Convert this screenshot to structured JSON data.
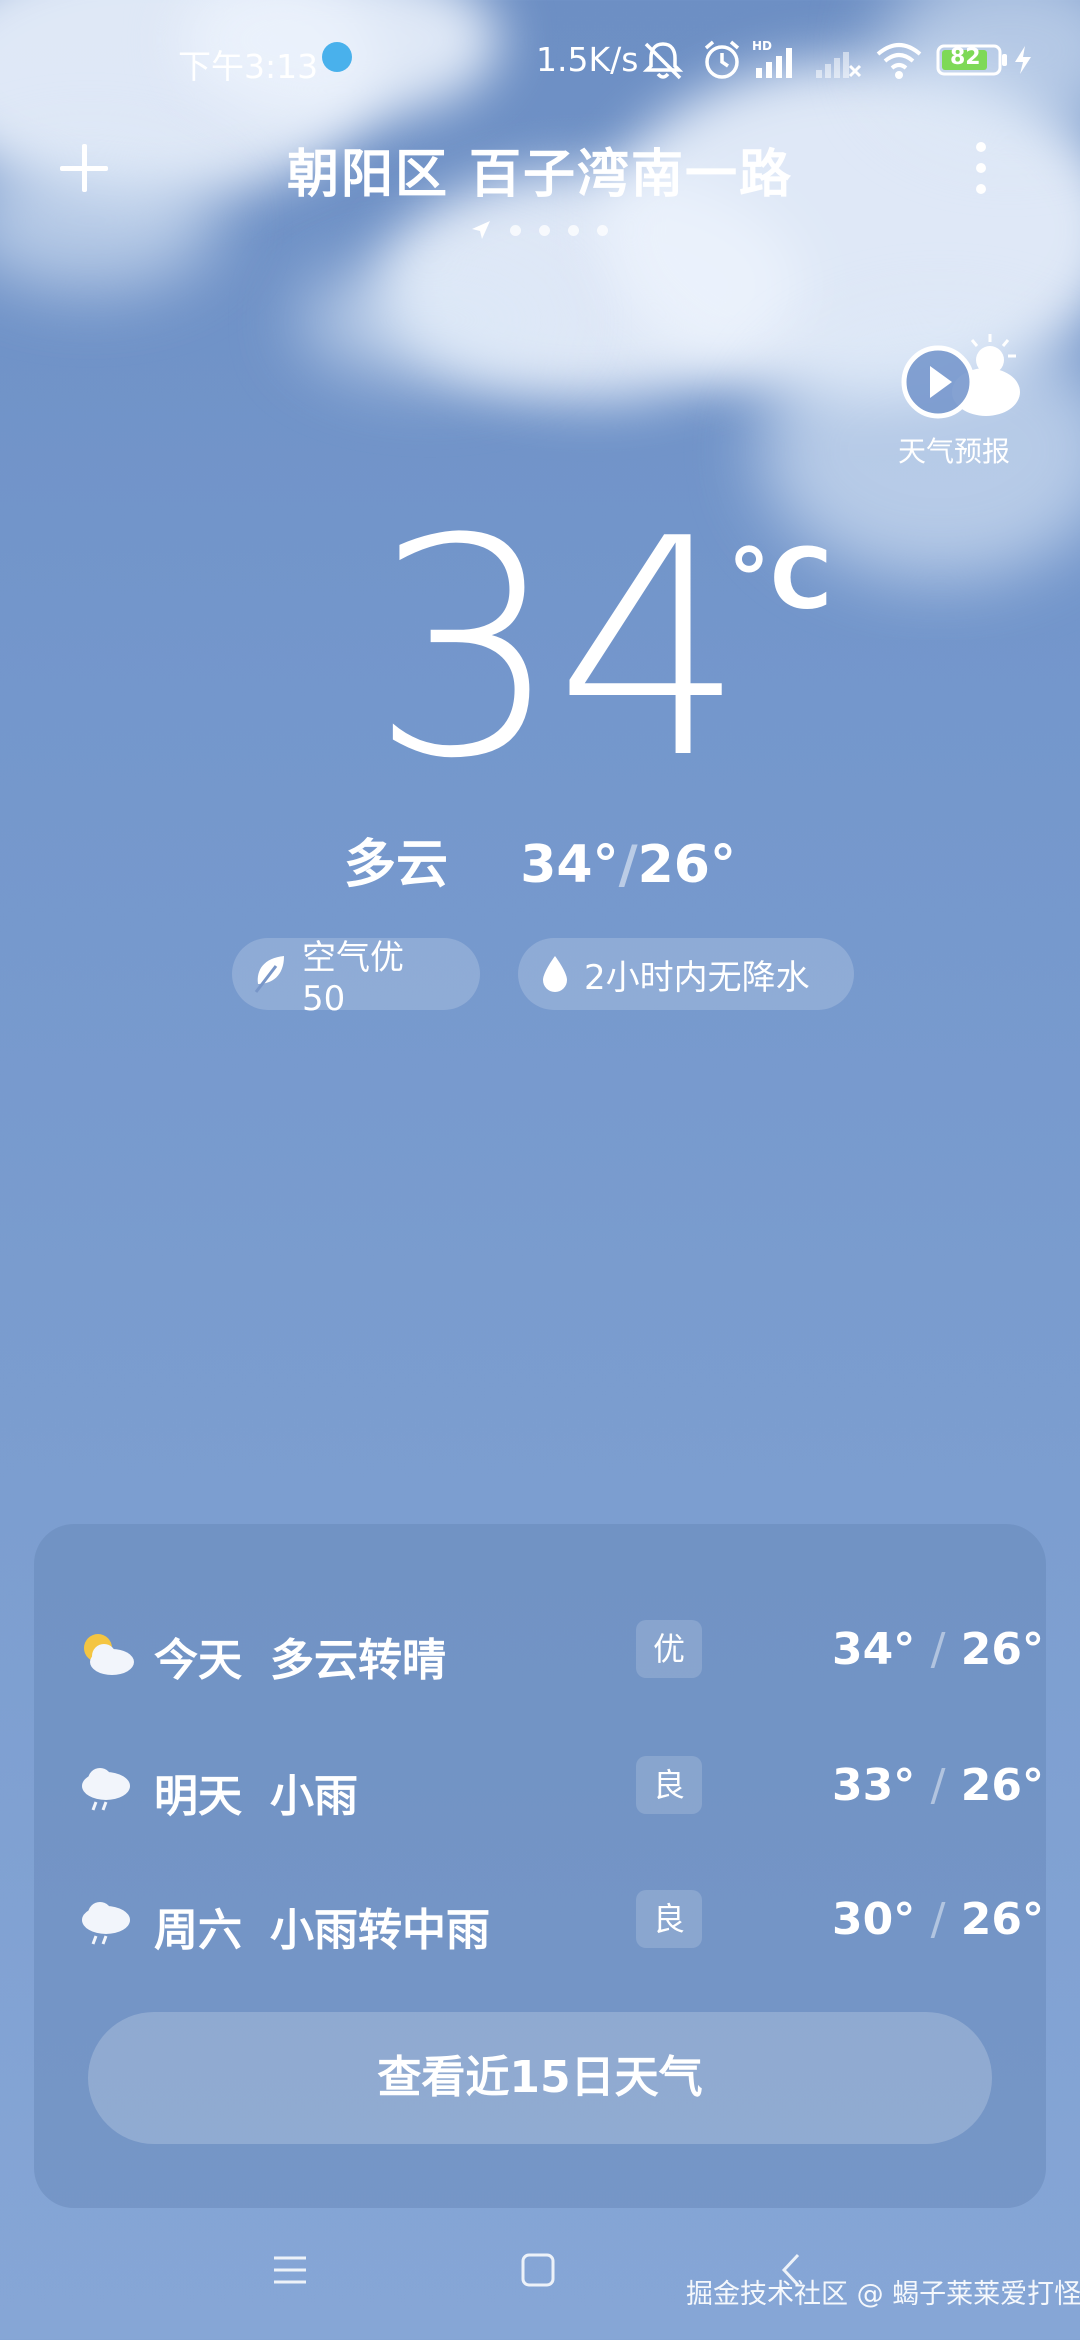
{
  "status_bar": {
    "time": "下午3:13",
    "net_speed": "1.5K/s",
    "battery": "82",
    "icons": [
      "mute-bell-icon",
      "alarm-icon",
      "hd-signal-icon",
      "signal-no-sim-icon",
      "wifi-icon",
      "battery-icon",
      "charging-icon"
    ]
  },
  "header": {
    "location": "朝阳区 百子湾南一路",
    "add_icon": "plus-icon",
    "more_icon": "vertical-dots-icon",
    "pages": [
      "location-arrow-icon",
      "dot",
      "dot",
      "dot",
      "dot"
    ]
  },
  "forecast_video": {
    "label": "天气预报",
    "icon": "play-sun-cloud-icon"
  },
  "current": {
    "temp": "34",
    "unit": "°C",
    "condition": "多云",
    "high": "34°",
    "low": "26°",
    "separator": "/"
  },
  "badges": [
    {
      "icon": "leaf-icon",
      "text": "空气优 50"
    },
    {
      "icon": "water-drop-icon",
      "text": "2小时内无降水"
    }
  ],
  "forecast": [
    {
      "icon": "partly-sunny-icon",
      "day": "今天",
      "condition": "多云转晴",
      "aqi": "优",
      "high": "34°",
      "low": "26°"
    },
    {
      "icon": "rain-cloud-icon",
      "day": "明天",
      "condition": "小雨",
      "aqi": "良",
      "high": "33°",
      "low": "26°"
    },
    {
      "icon": "rain-cloud-icon",
      "day": "周六",
      "condition": "小雨转中雨",
      "aqi": "良",
      "high": "30°",
      "low": "26°"
    }
  ],
  "range_separator": "/",
  "fifteen_day_button": "查看近15日天气",
  "nav": {
    "menu_icon": "menu-lines-icon",
    "home_icon": "square-home-icon",
    "back_icon": "back-chevron-icon"
  },
  "watermark": "掘金技术社区 @ 蝎子莱莱爱打怪",
  "colors": {
    "background_top": "#6d8fc4",
    "background_bottom": "#86a6d6",
    "card": "#6484b6",
    "battery_fill": "#7ed957"
  }
}
